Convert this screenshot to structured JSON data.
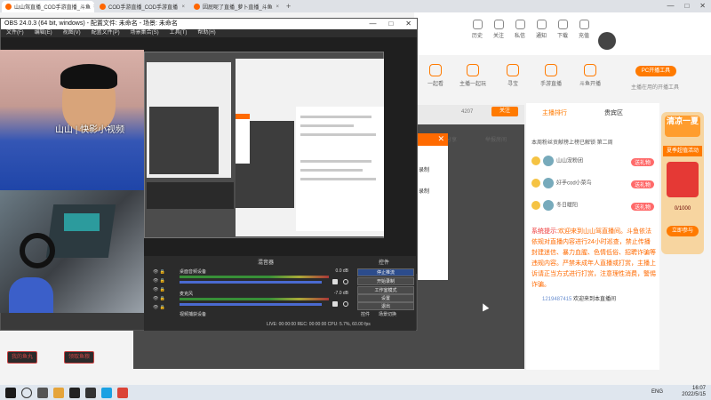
{
  "browser": {
    "tabs": [
      {
        "label": "山山驾直播_COD手游直播_斗鱼",
        "active": true
      },
      {
        "label": "COD手游直播_COD手游直播",
        "active": false
      },
      {
        "label": "因屁呢了直播_萝卜直播_斗鱼",
        "active": false
      }
    ],
    "new_tab": "+",
    "window_controls": [
      "—",
      "□",
      "✕"
    ]
  },
  "obs": {
    "title": "OBS 24.0.3 (64 bit, windows) - 配置文件: 未命名 - 场景: 未命名",
    "window_controls": [
      "—",
      "□",
      "✕"
    ],
    "menu": [
      "文件(F)",
      "编辑(E)",
      "视图(V)",
      "配置文件(P)",
      "场景集合(S)",
      "工具(T)",
      "帮助(H)"
    ],
    "watermark": "山山 | 快影小视频",
    "mixer_header": "混音器",
    "controls_header": "控件",
    "mixer": [
      {
        "name": "桌面音频设备",
        "db": "0.0 dB"
      },
      {
        "name": "麦克风",
        "db": "-7.0 dB"
      },
      {
        "name": "视频捕获设备",
        "db": "0.0 dB"
      }
    ],
    "controls": [
      "停止推流",
      "开始录制",
      "工作室模式",
      "设置",
      "退出"
    ],
    "control_tabs": [
      "控件",
      "场景切换"
    ],
    "status": "LIVE: 00:00:00   REC: 00:00:00   CPU: 5.7%, 60.00 fps"
  },
  "douyu": {
    "nav_icons": [
      "历史",
      "关注",
      "私信",
      "通知",
      "下载",
      "充值"
    ],
    "categories": [
      "一起看",
      "主播一起玩",
      "寻宝",
      "手游直播",
      "斗鱼开播"
    ],
    "pc_button": "PC开播工具",
    "pc_sub": "主播在用的开播工具",
    "fans": "4207",
    "follow": "关注",
    "share": "分享",
    "report": "举报房间",
    "chat_tabs": [
      "主播排行",
      "贵宾区"
    ],
    "chat_note": "本周粉丝贡献榜上榜已解锁 第二周",
    "rank": [
      {
        "name": "山山宠粉团",
        "gift": "送礼物"
      },
      {
        "name": "好手cod小菜鸟",
        "gift": "送礼物"
      },
      {
        "name": "冬日暖阳",
        "gift": "送礼物"
      }
    ],
    "sys_label": "系统提示:",
    "sys_msg": "欢迎来到山山驾直播间。斗鱼依法依规对直播内容进行24小时巡查，禁止传播封建迷信、暴力血腥、色情低俗、招聘诈骗等违规内容。严禁未成年人直播或打赏，主播上诉请正当方式进行打赏，注意理性消费，警惕诈骗。",
    "chat_user": "1219487415",
    "chat_msg": "欢迎来到本直播间",
    "promo": {
      "t1": "清凉一夏",
      "t2": "夏季超值活动",
      "t3": "0/1000",
      "t4": "立即参与"
    },
    "left_buttons": [
      "我的鱼丸",
      "领取鱼粮"
    ],
    "dialog_lines": [
      "录制",
      "录制"
    ]
  },
  "taskbar": {
    "lang": "ENG",
    "time": "16:07",
    "date": "2022/5/15"
  },
  "colors": {
    "accent": "#ff7a00",
    "obs_bg": "#2b2b2b"
  }
}
